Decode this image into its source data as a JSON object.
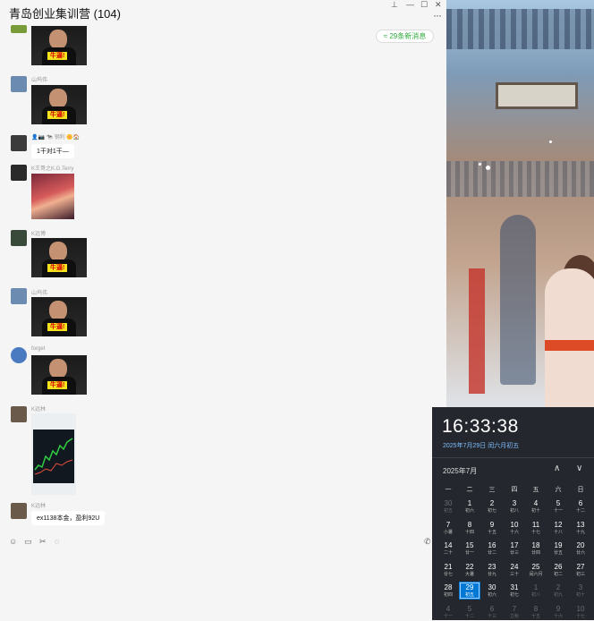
{
  "chat": {
    "title": "青岛创业集训营 (104)",
    "new_messages": "≈ 29条新消息",
    "window_controls": [
      "⊥",
      "—",
      "☐",
      "✕"
    ],
    "more": "···",
    "sticker_caption": "牛逼!",
    "messages": [
      {
        "user": "",
        "avatar_color": "#7a9b3a"
      },
      {
        "user": "山坞伟",
        "avatar_color": "#6b8bb0"
      },
      {
        "user": "👤📷 🐄 钢利 🌼🏠",
        "avatar_color": "#3b3b3b",
        "text": "1干对1干—"
      },
      {
        "user": "K王哥之K.G.Terry",
        "avatar_color": "#2a2a2a"
      },
      {
        "user": "K远博",
        "avatar_color": "#3a4a3a"
      },
      {
        "user": "山坞伟",
        "avatar_color": "#6b8bb0"
      },
      {
        "user": "forget",
        "avatar_color": "#4a7ac0"
      },
      {
        "user": "K远林",
        "avatar_color": "#6a5a4a"
      },
      {
        "user": "K远林",
        "avatar_color": "#6a5a4a",
        "text": "ex1138本金，盈利92U"
      }
    ],
    "toolbar_icons": [
      "emoji-icon",
      "folder-icon",
      "scissors-icon",
      "chat-history-icon",
      "phone-icon"
    ]
  },
  "calendar": {
    "time": "16:33:38",
    "date": "2025年7月29日 闰六月初五",
    "month_label": "2025年7月",
    "weekdays": [
      "一",
      "二",
      "三",
      "四",
      "五",
      "六",
      "日"
    ],
    "days": [
      {
        "n": "30",
        "l": "初五",
        "other": true
      },
      {
        "n": "1",
        "l": "初六"
      },
      {
        "n": "2",
        "l": "初七"
      },
      {
        "n": "3",
        "l": "初八"
      },
      {
        "n": "4",
        "l": "初十"
      },
      {
        "n": "5",
        "l": "十一"
      },
      {
        "n": "6",
        "l": "十二"
      },
      {
        "n": "7",
        "l": "小暑"
      },
      {
        "n": "8",
        "l": "十四"
      },
      {
        "n": "9",
        "l": "十五"
      },
      {
        "n": "10",
        "l": "十六"
      },
      {
        "n": "11",
        "l": "十七"
      },
      {
        "n": "12",
        "l": "十八"
      },
      {
        "n": "13",
        "l": "十九"
      },
      {
        "n": "14",
        "l": "二十"
      },
      {
        "n": "15",
        "l": "廿一"
      },
      {
        "n": "16",
        "l": "廿二"
      },
      {
        "n": "17",
        "l": "廿三"
      },
      {
        "n": "18",
        "l": "廿四"
      },
      {
        "n": "19",
        "l": "廿五"
      },
      {
        "n": "20",
        "l": "廿六"
      },
      {
        "n": "21",
        "l": "廿七"
      },
      {
        "n": "22",
        "l": "大暑"
      },
      {
        "n": "23",
        "l": "廿九"
      },
      {
        "n": "24",
        "l": "三十"
      },
      {
        "n": "25",
        "l": "闰六月"
      },
      {
        "n": "26",
        "l": "初二"
      },
      {
        "n": "27",
        "l": "初三"
      },
      {
        "n": "28",
        "l": "初四"
      },
      {
        "n": "29",
        "l": "初五",
        "today": true
      },
      {
        "n": "30",
        "l": "初六"
      },
      {
        "n": "31",
        "l": "初七"
      },
      {
        "n": "1",
        "l": "初八",
        "other": true
      },
      {
        "n": "2",
        "l": "初九",
        "other": true
      },
      {
        "n": "3",
        "l": "初十",
        "other": true
      },
      {
        "n": "4",
        "l": "十一",
        "other": true
      },
      {
        "n": "5",
        "l": "十二",
        "other": true
      },
      {
        "n": "6",
        "l": "十三",
        "other": true
      },
      {
        "n": "7",
        "l": "立秋",
        "other": true
      },
      {
        "n": "8",
        "l": "十五",
        "other": true
      },
      {
        "n": "9",
        "l": "十六",
        "other": true
      },
      {
        "n": "10",
        "l": "十七",
        "other": true
      }
    ],
    "accent": "#0078d4"
  }
}
